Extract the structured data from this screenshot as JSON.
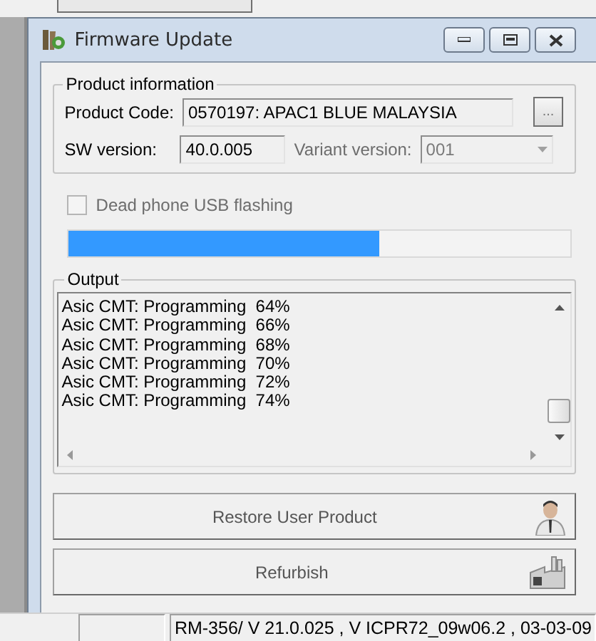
{
  "window": {
    "title": "Firmware Update"
  },
  "product_information": {
    "title": "Product information",
    "product_code": {
      "label": "Product Code:",
      "value": "0570197: APAC1 BLUE MALAYSIA",
      "browse_button": "..."
    },
    "sw_version": {
      "label": "SW version:",
      "value": "40.0.005"
    },
    "variant_version": {
      "label": "Variant version:",
      "value": "001",
      "disabled": true
    }
  },
  "dead_phone_usb_flashing": {
    "label": "Dead phone USB flashing",
    "checked": false,
    "disabled": true
  },
  "progress": {
    "level": 0.62
  },
  "output": {
    "title": "Output",
    "lines": [
      "Asic CMT: Programming  64%",
      "Asic CMT: Programming  66%",
      "Asic CMT: Programming  68%",
      "Asic CMT: Programming  70%",
      "Asic CMT: Programming  72%",
      "Asic CMT: Programming  74%"
    ]
  },
  "buttons": [
    {
      "label": "Restore User Product",
      "kind": "person"
    },
    {
      "label": "Refurbish",
      "kind": "factory"
    }
  ],
  "status_bar": {
    "panel_2": "RM-356/ V 21.0.025 , V ICPR72_09w06.2 , 03-03-09"
  }
}
